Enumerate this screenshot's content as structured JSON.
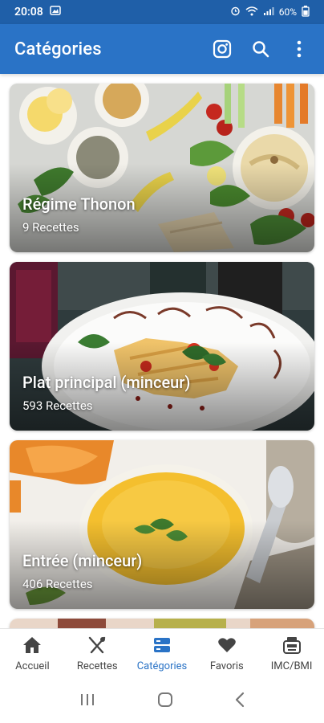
{
  "status": {
    "time": "20:08",
    "battery": "60%"
  },
  "header": {
    "title": "Catégories"
  },
  "colors": {
    "app_bar": "#2a73c6",
    "status_bar": "#1f5fa8",
    "active_nav": "#2a73c6"
  },
  "categories": [
    {
      "title": "Régime Thonon",
      "count": "9 Recettes"
    },
    {
      "title": "Plat principal (minceur)",
      "count": "593 Recettes"
    },
    {
      "title": "Entrée (minceur)",
      "count": "406 Recettes"
    }
  ],
  "nav": [
    {
      "label": "Accueil",
      "icon": "home-icon"
    },
    {
      "label": "Recettes",
      "icon": "utensils-icon"
    },
    {
      "label": "Catégories",
      "icon": "categories-icon",
      "active": true
    },
    {
      "label": "Favoris",
      "icon": "heart-icon"
    },
    {
      "label": "IMC/BMI",
      "icon": "scale-icon"
    }
  ]
}
